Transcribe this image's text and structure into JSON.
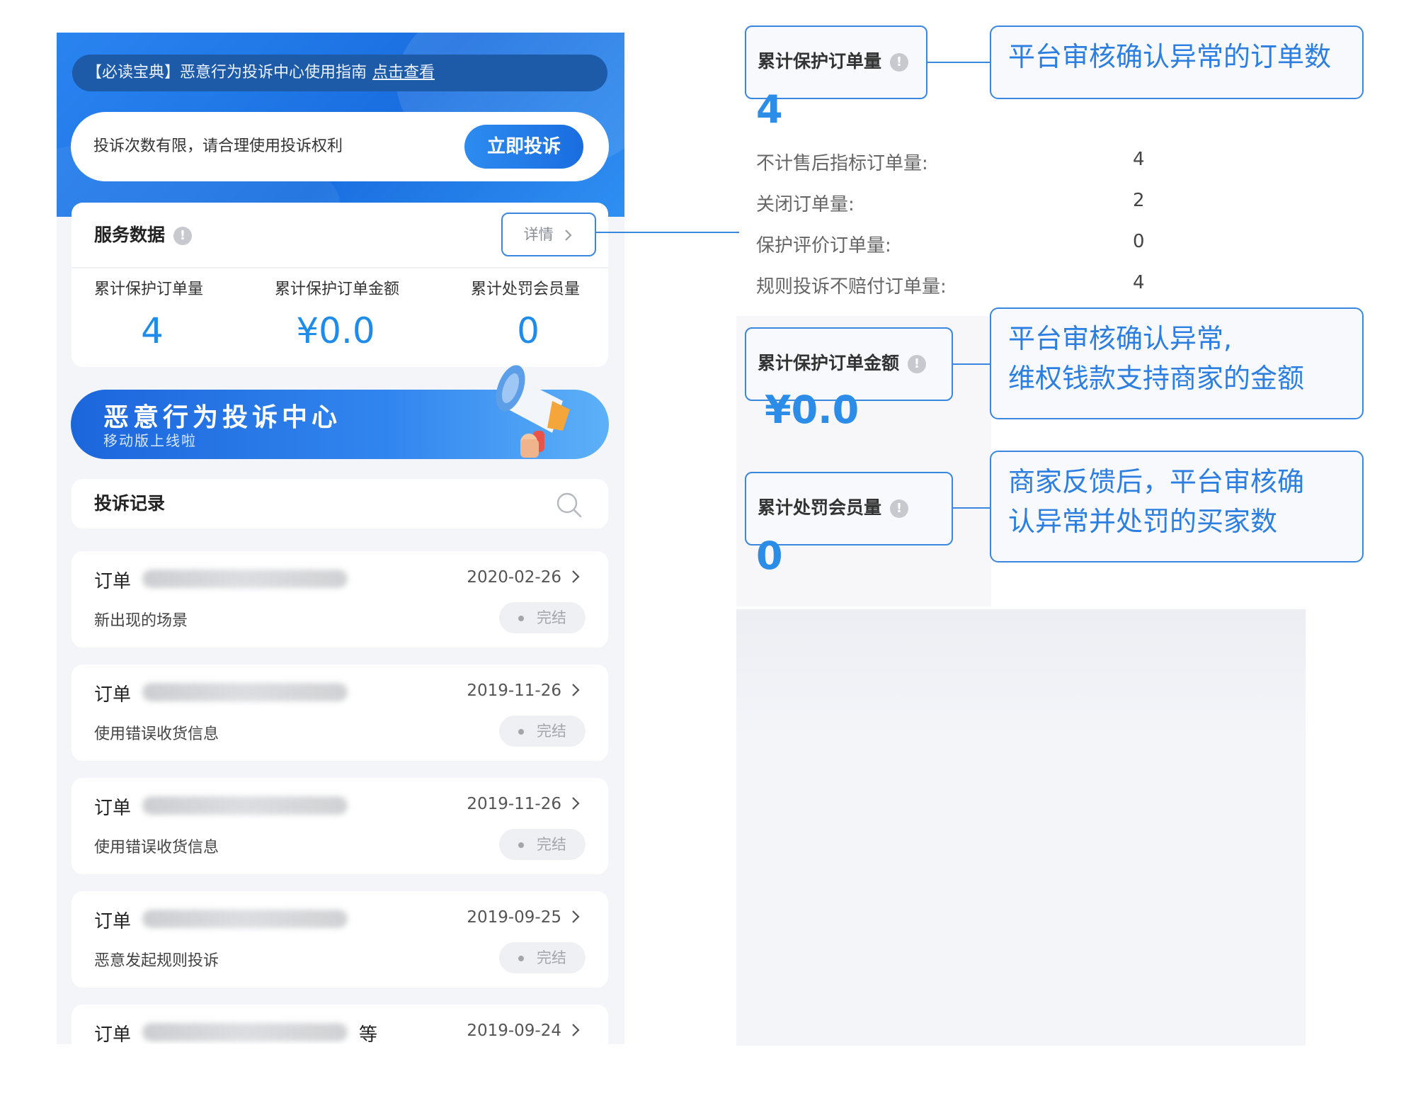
{
  "phone": {
    "notice": {
      "text": "【必读宝典】恶意行为投诉中心使用指南",
      "link": "点击查看"
    },
    "cta": {
      "hint": "投诉次数有限，请合理使用投诉权利",
      "button": "立即投诉"
    },
    "service": {
      "title": "服务数据",
      "detail": "详情",
      "stats": [
        {
          "label": "累计保护订单量",
          "value": "4"
        },
        {
          "label": "累计保护订单金额",
          "value": "¥0.0"
        },
        {
          "label": "累计处罚会员量",
          "value": "0"
        }
      ]
    },
    "banner": {
      "title": "恶意行为投诉中心",
      "subtitle": "移动版上线啦"
    },
    "record_title": "投诉记录",
    "orders": [
      {
        "label": "订单",
        "date": "2020-02-26",
        "desc": "新出现的场景",
        "status": "完结",
        "extra": ""
      },
      {
        "label": "订单",
        "date": "2019-11-26",
        "desc": "使用错误收货信息",
        "status": "完结",
        "extra": ""
      },
      {
        "label": "订单",
        "date": "2019-11-26",
        "desc": "使用错误收货信息",
        "status": "完结",
        "extra": ""
      },
      {
        "label": "订单",
        "date": "2019-09-25",
        "desc": "恶意发起规则投诉",
        "status": "完结",
        "extra": ""
      },
      {
        "label": "订单",
        "date": "2019-09-24",
        "desc": "",
        "status": "",
        "extra": "等"
      }
    ]
  },
  "annotations": {
    "protect_count": {
      "label": "累计保护订单量",
      "value": "4",
      "desc": "平台审核确认异常的订单数",
      "metrics": [
        {
          "k": "不计售后指标订单量:",
          "v": "4"
        },
        {
          "k": "关闭订单量:",
          "v": "2"
        },
        {
          "k": "保护评价订单量:",
          "v": "0"
        },
        {
          "k": "规则投诉不赔付订单量:",
          "v": "4"
        }
      ]
    },
    "protect_amount": {
      "label": "累计保护订单金额",
      "value": "¥0.0",
      "desc_line1": "平台审核确认异常,",
      "desc_line2": "维权钱款支持商家的金额"
    },
    "penalty": {
      "label": "累计处罚会员量",
      "value": "0",
      "desc_line1": "商家反馈后，平台审核确",
      "desc_line2": "认异常并处罚的买家数"
    }
  },
  "colors": {
    "accent": "#2c8de8",
    "callout_border": "#3a87e0",
    "hero": "#1a6fe0"
  }
}
